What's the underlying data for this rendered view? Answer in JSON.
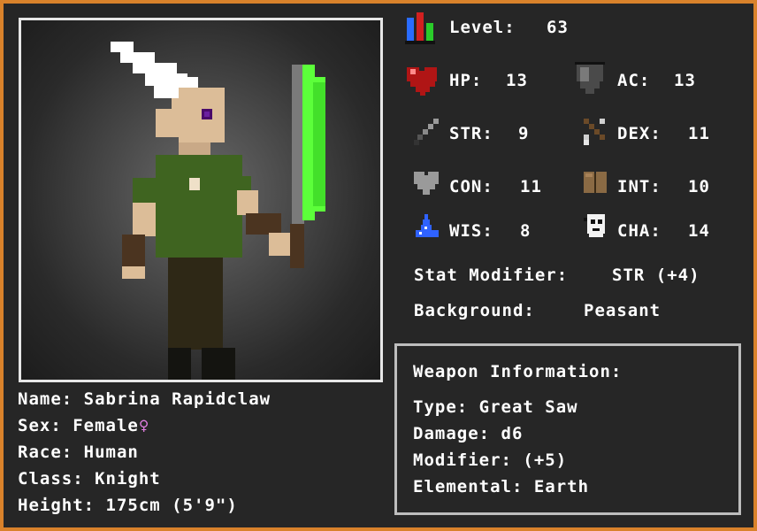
{
  "level": {
    "label": "Level:",
    "value": "63"
  },
  "stats": {
    "hp": {
      "label": "HP:",
      "value": "13"
    },
    "ac": {
      "label": "AC:",
      "value": "13"
    },
    "str": {
      "label": "STR:",
      "value": "9"
    },
    "dex": {
      "label": "DEX:",
      "value": "11"
    },
    "con": {
      "label": "CON:",
      "value": "11"
    },
    "int": {
      "label": "INT:",
      "value": "10"
    },
    "wis": {
      "label": "WIS:",
      "value": "8"
    },
    "cha": {
      "label": "CHA:",
      "value": "14"
    }
  },
  "stat_modifier": {
    "label": "Stat Modifier:",
    "value": "STR (+4)"
  },
  "background": {
    "label": "Background:",
    "value": "Peasant"
  },
  "character": {
    "name": "Name: Sabrina Rapidclaw",
    "sex": "Sex: Female",
    "sex_symbol": "♀",
    "race": "Race: Human",
    "class": "Class: Knight",
    "height": "Height: 175cm (5'9\")"
  },
  "weapon": {
    "title": "Weapon Information:",
    "type": "Type: Great Saw",
    "damage": "Damage: d6",
    "modifier": "Modifier: (+5)",
    "elemental": "Elemental: Earth"
  },
  "icons": {
    "level": "bar-chart-icon",
    "hp": "heart-icon",
    "ac": "shield-icon",
    "str": "sword-icon",
    "dex": "bow-icon",
    "con": "gray-heart-icon",
    "int": "book-icon",
    "wis": "wizard-hat-icon",
    "cha": "mask-icon"
  },
  "colors": {
    "border": "#d9822b",
    "panel": "#262626",
    "text": "#ffffff",
    "blade": "#5cff3a"
  }
}
